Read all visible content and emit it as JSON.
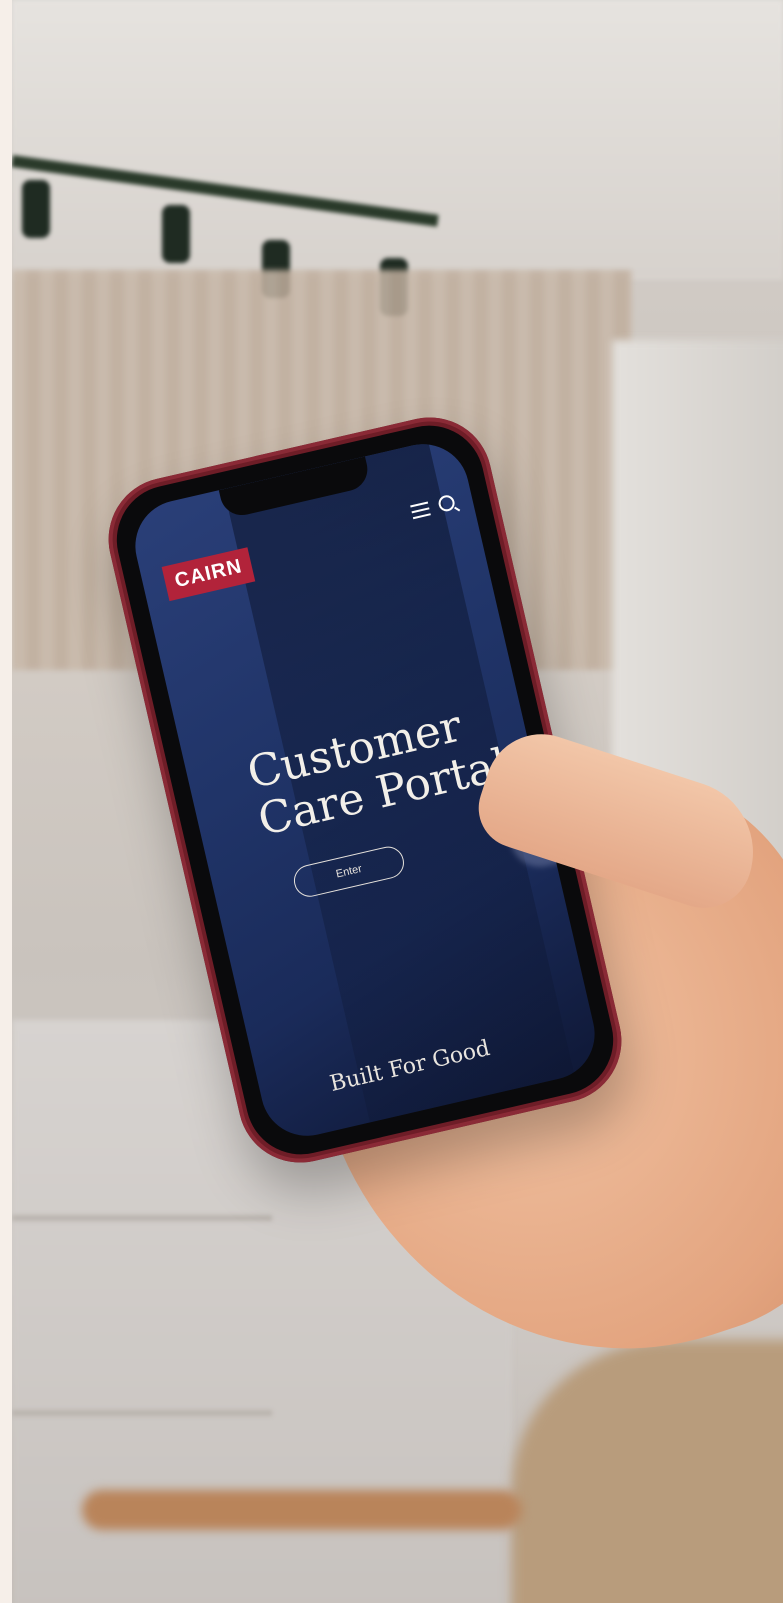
{
  "screen": {
    "logo_text": "CAIRN",
    "title_line1": "Customer",
    "title_line2": "Care Portal",
    "enter_label": "Enter",
    "tagline": "Built For Good"
  },
  "colors": {
    "brand_red": "#b2233a",
    "screen_navy": "#1f3368",
    "phone_frame": "#6e1d27"
  }
}
